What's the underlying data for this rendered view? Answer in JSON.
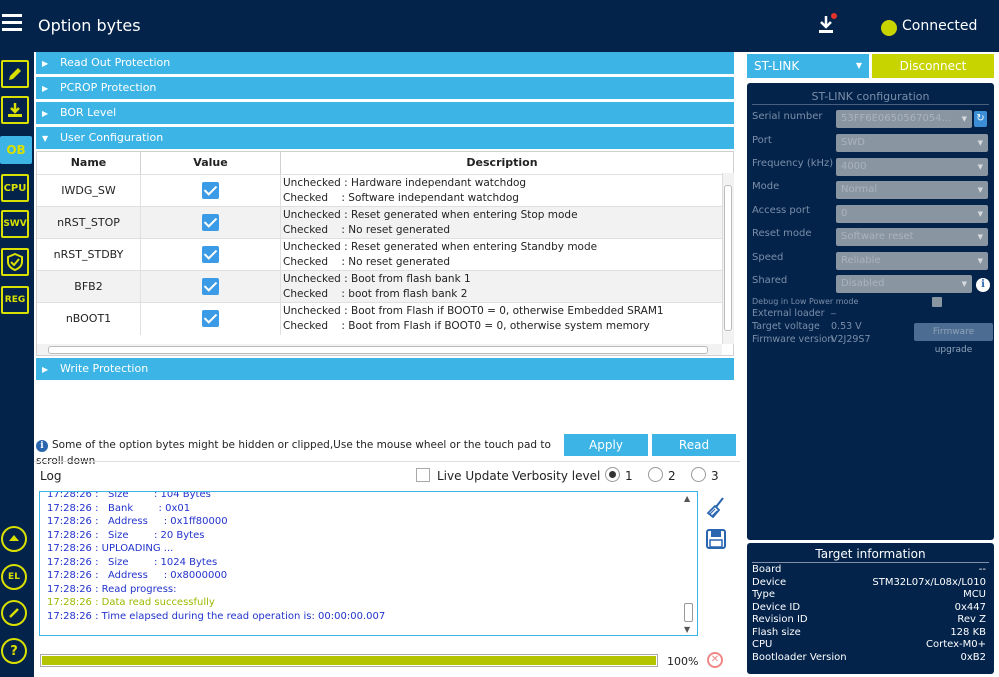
{
  "header": {
    "title": "Option bytes",
    "status": "Connected",
    "colors": {
      "bg": "#03234b",
      "accent": "#3cb4e6",
      "status_dot": "#c8d400"
    }
  },
  "sidebar": {
    "items": [
      {
        "name": "edit",
        "label": ""
      },
      {
        "name": "download",
        "label": ""
      },
      {
        "name": "ob",
        "label": "OB"
      },
      {
        "name": "cpu",
        "label": "CPU"
      },
      {
        "name": "swv",
        "label": "SWV"
      },
      {
        "name": "shield",
        "label": ""
      },
      {
        "name": "reg",
        "label": "REG"
      }
    ],
    "bottom": [
      {
        "name": "beta",
        "label": ""
      },
      {
        "name": "el",
        "label": "EL"
      },
      {
        "name": "link",
        "label": ""
      },
      {
        "name": "help",
        "label": "?"
      }
    ]
  },
  "sections": {
    "read_out": "Read Out Protection",
    "pcrop": "PCROP Protection",
    "bor": "BOR Level",
    "user_config": "User Configuration",
    "write_protection": "Write Protection"
  },
  "table": {
    "headers": {
      "name": "Name",
      "value": "Value",
      "description": "Description"
    },
    "rows": [
      {
        "name": "IWDG_SW",
        "checked": true,
        "desc1": "Unchecked : Hardware independant watchdog",
        "desc2": "Checked    : Software independant watchdog"
      },
      {
        "name": "nRST_STOP",
        "checked": true,
        "desc1": "Unchecked : Reset generated when entering Stop mode",
        "desc2": "Checked    : No reset generated"
      },
      {
        "name": "nRST_STDBY",
        "checked": true,
        "desc1": "Unchecked : Reset generated when entering Standby mode",
        "desc2": "Checked    : No reset generated"
      },
      {
        "name": "BFB2",
        "checked": true,
        "desc1": "Unchecked : Boot from flash bank 1",
        "desc2": "Checked    : boot from flash bank 2"
      },
      {
        "name": "nBOOT1",
        "checked": true,
        "desc1": "Unchecked : Boot from Flash if BOOT0 = 0, otherwise Embedded SRAM1",
        "desc2": "Checked    : Boot from Flash if BOOT0 = 0, otherwise system memory"
      }
    ]
  },
  "info_text": "Some of the option bytes might be hidden or clipped,Use the mouse wheel or the touch pad to scroll down",
  "buttons": {
    "apply": "Apply",
    "read": "Read"
  },
  "log": {
    "label": "Log",
    "live_update": "Live Update",
    "verbosity_label": "Verbosity level",
    "verbosity_options": [
      "1",
      "2",
      "3"
    ],
    "verbosity_selected": "1",
    "lines": [
      {
        "text": "17:28:26 :   Size        : 104 Bytes",
        "color": "blue"
      },
      {
        "text": "17:28:26 :   Bank        : 0x01",
        "color": "blue"
      },
      {
        "text": "17:28:26 :   Address     : 0x1ff80000",
        "color": "blue"
      },
      {
        "text": "17:28:26 :   Size        : 20 Bytes",
        "color": "blue"
      },
      {
        "text": "17:28:26 : UPLOADING ...",
        "color": "blue"
      },
      {
        "text": "17:28:26 :   Size        : 1024 Bytes",
        "color": "blue"
      },
      {
        "text": "17:28:26 :   Address     : 0x8000000",
        "color": "blue"
      },
      {
        "text": "17:28:26 : Read progress:",
        "color": "blue"
      },
      {
        "text": "17:28:26 : Data read successfully",
        "color": "green"
      },
      {
        "text": "17:28:26 : Time elapsed during the read operation is: 00:00:00.007",
        "color": "blue"
      }
    ],
    "progress_percent": 100,
    "progress_text": "100%"
  },
  "right_panel": {
    "interface": "ST-LINK",
    "disconnect": "Disconnect",
    "config_title": "ST-LINK configuration",
    "fields": [
      {
        "label": "Serial number",
        "value": "53FF6E0650567054..."
      },
      {
        "label": "Port",
        "value": "SWD"
      },
      {
        "label": "Frequency (kHz)",
        "value": "4000"
      },
      {
        "label": "Mode",
        "value": "Normal"
      },
      {
        "label": "Access port",
        "value": "0"
      },
      {
        "label": "Reset mode",
        "value": "Software reset"
      },
      {
        "label": "Speed",
        "value": "Reliable"
      },
      {
        "label": "Shared",
        "value": "Disabled"
      }
    ],
    "debug_low_power": "Debug in Low Power mode",
    "external_loader": "External loader",
    "external_loader_value": "_",
    "target_voltage_label": "Target voltage",
    "target_voltage": "0.53 V",
    "firmware_version_label": "Firmware version",
    "firmware_version": "V2J29S7",
    "firmware_upgrade": "Firmware upgrade"
  },
  "target_info": {
    "title": "Target information",
    "rows": [
      {
        "k": "Board",
        "v": "--"
      },
      {
        "k": "Device",
        "v": "STM32L07x/L08x/L010"
      },
      {
        "k": "Type",
        "v": "MCU"
      },
      {
        "k": "Device ID",
        "v": "0x447"
      },
      {
        "k": "Revision ID",
        "v": "Rev Z"
      },
      {
        "k": "Flash size",
        "v": "128 KB"
      },
      {
        "k": "CPU",
        "v": "Cortex-M0+"
      },
      {
        "k": "Bootloader Version",
        "v": "0xB2"
      }
    ]
  }
}
